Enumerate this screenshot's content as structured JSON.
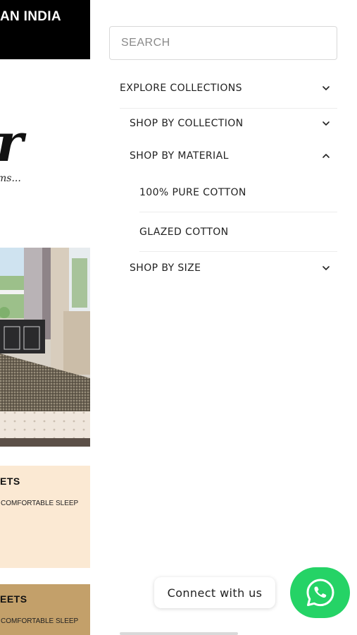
{
  "background_page": {
    "topbar_text": "AN INDIA",
    "logo_script_char": "r",
    "logo_tagline": "ms...",
    "card1": {
      "title": "ETS",
      "subtitle": "COMFORTABLE SLEEP"
    },
    "card2": {
      "title": "EETS",
      "subtitle": "COMFORTABLE SLEEP"
    }
  },
  "drawer": {
    "search": {
      "placeholder": "SEARCH",
      "value": ""
    },
    "nav": {
      "explore_collections": {
        "label": "EXPLORE COLLECTIONS",
        "expanded": true
      },
      "shop_by_collection": {
        "label": "SHOP BY COLLECTION",
        "expanded": false
      },
      "shop_by_material": {
        "label": "SHOP BY MATERIAL",
        "expanded": true,
        "items": [
          "100% PURE COTTON",
          "GLAZED COTTON"
        ]
      },
      "shop_by_size": {
        "label": "SHOP BY SIZE",
        "expanded": false
      }
    }
  },
  "connect": {
    "label": "Connect with us",
    "icon": "whatsapp-icon"
  },
  "colors": {
    "whatsapp_green": "#25d366",
    "topbar_black": "#000000",
    "card1_bg": "#fbe9d3",
    "card2_bg": "#c3a06a"
  }
}
